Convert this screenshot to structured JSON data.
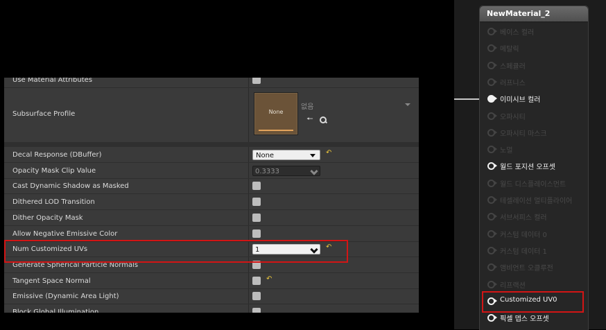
{
  "details": {
    "rows_top": [
      {
        "label": "Use Material Attributes",
        "type": "checkbox"
      }
    ],
    "subsurface": {
      "label": "Subsurface Profile",
      "thumb_label": "None",
      "combo_value": "없음"
    },
    "rows": [
      {
        "label": "Decal Response (DBuffer)",
        "type": "dropdown",
        "value": "None",
        "reset": true
      },
      {
        "label": "Opacity Mask Clip Value",
        "type": "number",
        "value": "0.3333"
      },
      {
        "label": "Cast Dynamic Shadow as Masked",
        "type": "checkbox"
      },
      {
        "label": "Dithered LOD Transition",
        "type": "checkbox"
      },
      {
        "label": "Dither Opacity Mask",
        "type": "checkbox"
      },
      {
        "label": "Allow Negative Emissive Color",
        "type": "checkbox"
      },
      {
        "label": "Num Customized UVs",
        "type": "number-active",
        "value": "1",
        "reset": true
      },
      {
        "label": "Generate Spherical Particle Normals",
        "type": "checkbox"
      },
      {
        "label": "Tangent Space Normal",
        "type": "checkbox",
        "reset": true
      },
      {
        "label": "Emissive (Dynamic Area Light)",
        "type": "checkbox"
      },
      {
        "label": "Block Global Illumination",
        "type": "checkbox"
      }
    ],
    "reset_glyph": "↶"
  },
  "node": {
    "title": "NewMaterial_2",
    "pins": [
      {
        "label": "베이스 컬러",
        "active": false,
        "filled": false
      },
      {
        "label": "메탈릭",
        "active": false,
        "filled": false
      },
      {
        "label": "스페큘러",
        "active": false,
        "filled": false
      },
      {
        "label": "러프니스",
        "active": false,
        "filled": false
      },
      {
        "label": "이미시브 컬러",
        "active": true,
        "filled": true
      },
      {
        "label": "오파시티",
        "active": false,
        "filled": false
      },
      {
        "label": "오파시티 마스크",
        "active": false,
        "filled": false
      },
      {
        "label": "노멀",
        "active": false,
        "filled": false
      },
      {
        "label": "월드 포지션 오프셋",
        "active": true,
        "filled": false
      },
      {
        "label": "월드 디스플레이스먼트",
        "active": false,
        "filled": false
      },
      {
        "label": "테셀레이션 멀티플라이어",
        "active": false,
        "filled": false
      },
      {
        "label": "서브서피스 컬러",
        "active": false,
        "filled": false
      },
      {
        "label": "커스텀 데이터 0",
        "active": false,
        "filled": false
      },
      {
        "label": "커스텀 데이터 1",
        "active": false,
        "filled": false
      },
      {
        "label": "앰비언트 오클루전",
        "active": false,
        "filled": false
      },
      {
        "label": "리프랙션",
        "active": false,
        "filled": false
      },
      {
        "label": "Customized UV0",
        "active": true,
        "filled": false
      },
      {
        "label": "픽셀 뎁스 오프셋",
        "active": true,
        "filled": false
      }
    ]
  },
  "colors": {
    "highlight": "#d31515",
    "reset_accent": "#e8c33c",
    "panel_bg": "#3a3a3a",
    "node_header": "#5a5a5a"
  }
}
